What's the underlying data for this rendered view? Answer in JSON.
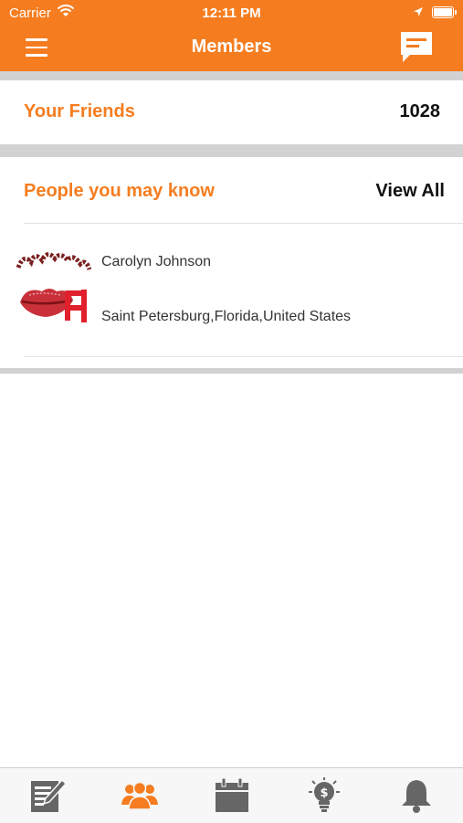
{
  "status_bar": {
    "carrier": "Carrier",
    "time": "12:11 PM",
    "icons": [
      "wifi-icon",
      "location-arrow-icon",
      "battery-icon"
    ]
  },
  "nav": {
    "title": "Members",
    "left_icon": "hamburger-menu-icon",
    "right_icon": "chat-bubble-icon"
  },
  "friends": {
    "label": "Your Friends",
    "count": "1028"
  },
  "people_you_may_know": {
    "label": "People you may know",
    "view_all": "View All",
    "members": [
      {
        "name": "Carolyn Johnson",
        "location": "Saint Petersburg,Florida,United States",
        "avatar": "lips-logo-avatar"
      }
    ]
  },
  "tab_bar": {
    "items": [
      {
        "icon": "edit-document-icon",
        "active": false
      },
      {
        "icon": "members-group-icon",
        "active": true
      },
      {
        "icon": "calendar-icon",
        "active": false
      },
      {
        "icon": "lightbulb-dollar-icon",
        "active": false
      },
      {
        "icon": "bell-icon",
        "active": false
      }
    ]
  },
  "colors": {
    "accent": "#f57d20",
    "inactive_icon": "#666666",
    "separator": "#d2d2d2"
  }
}
